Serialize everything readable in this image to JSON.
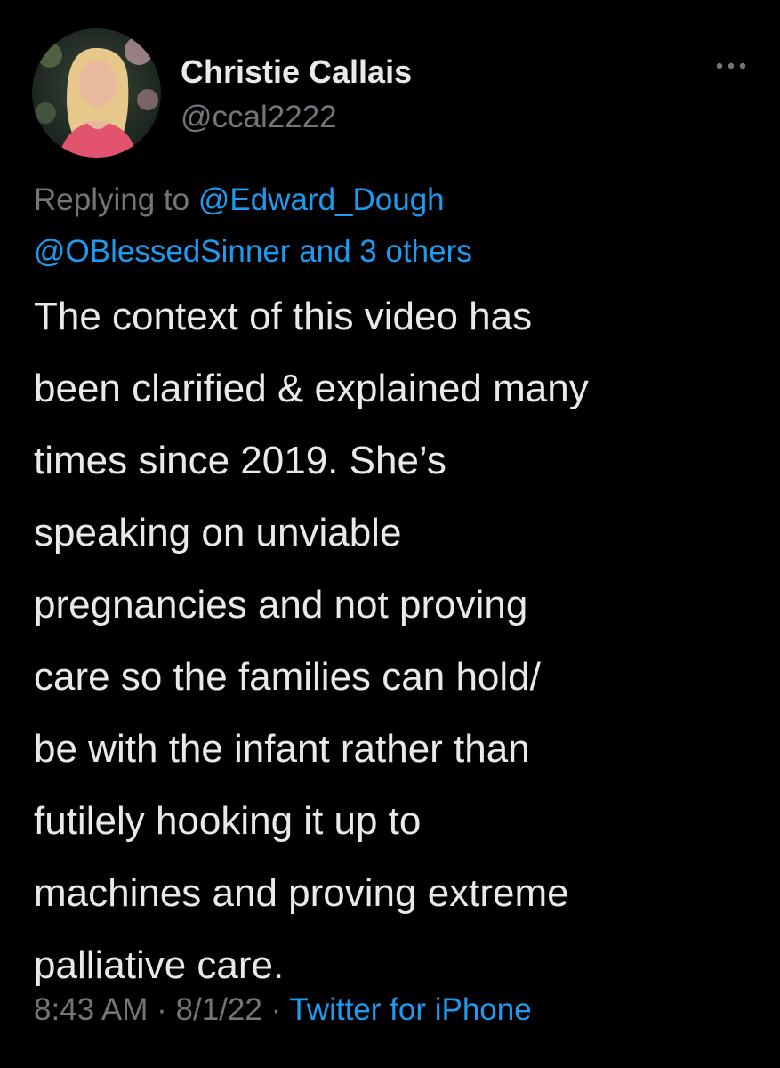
{
  "author": {
    "name": "Christie Callais",
    "handle": "@ccal2222",
    "avatar_icon": "profile-photo"
  },
  "more_icon": "more-dots-icon",
  "reply_context": {
    "prefix": "Replying to",
    "user1": "@Edward_Dough",
    "user2": "@OBlessedSinner",
    "others": "and 3 others"
  },
  "tweet": {
    "lines": [
      "The context of this video has",
      "been clarified & explained many",
      "times since 2019. She’s",
      "speaking on unviable",
      "pregnancies and not proving",
      "care so the families can hold/",
      "be with the infant rather than",
      "futilely hooking it up to",
      "machines and proving extreme",
      "palliative care."
    ]
  },
  "meta": {
    "time": "8:43 AM",
    "separator": "·",
    "date": "8/1/22",
    "source": "Twitter for iPhone"
  },
  "colors": {
    "background": "#000000",
    "text": "#e7e9ea",
    "secondary": "#71767b",
    "link": "#1d9bf0"
  }
}
